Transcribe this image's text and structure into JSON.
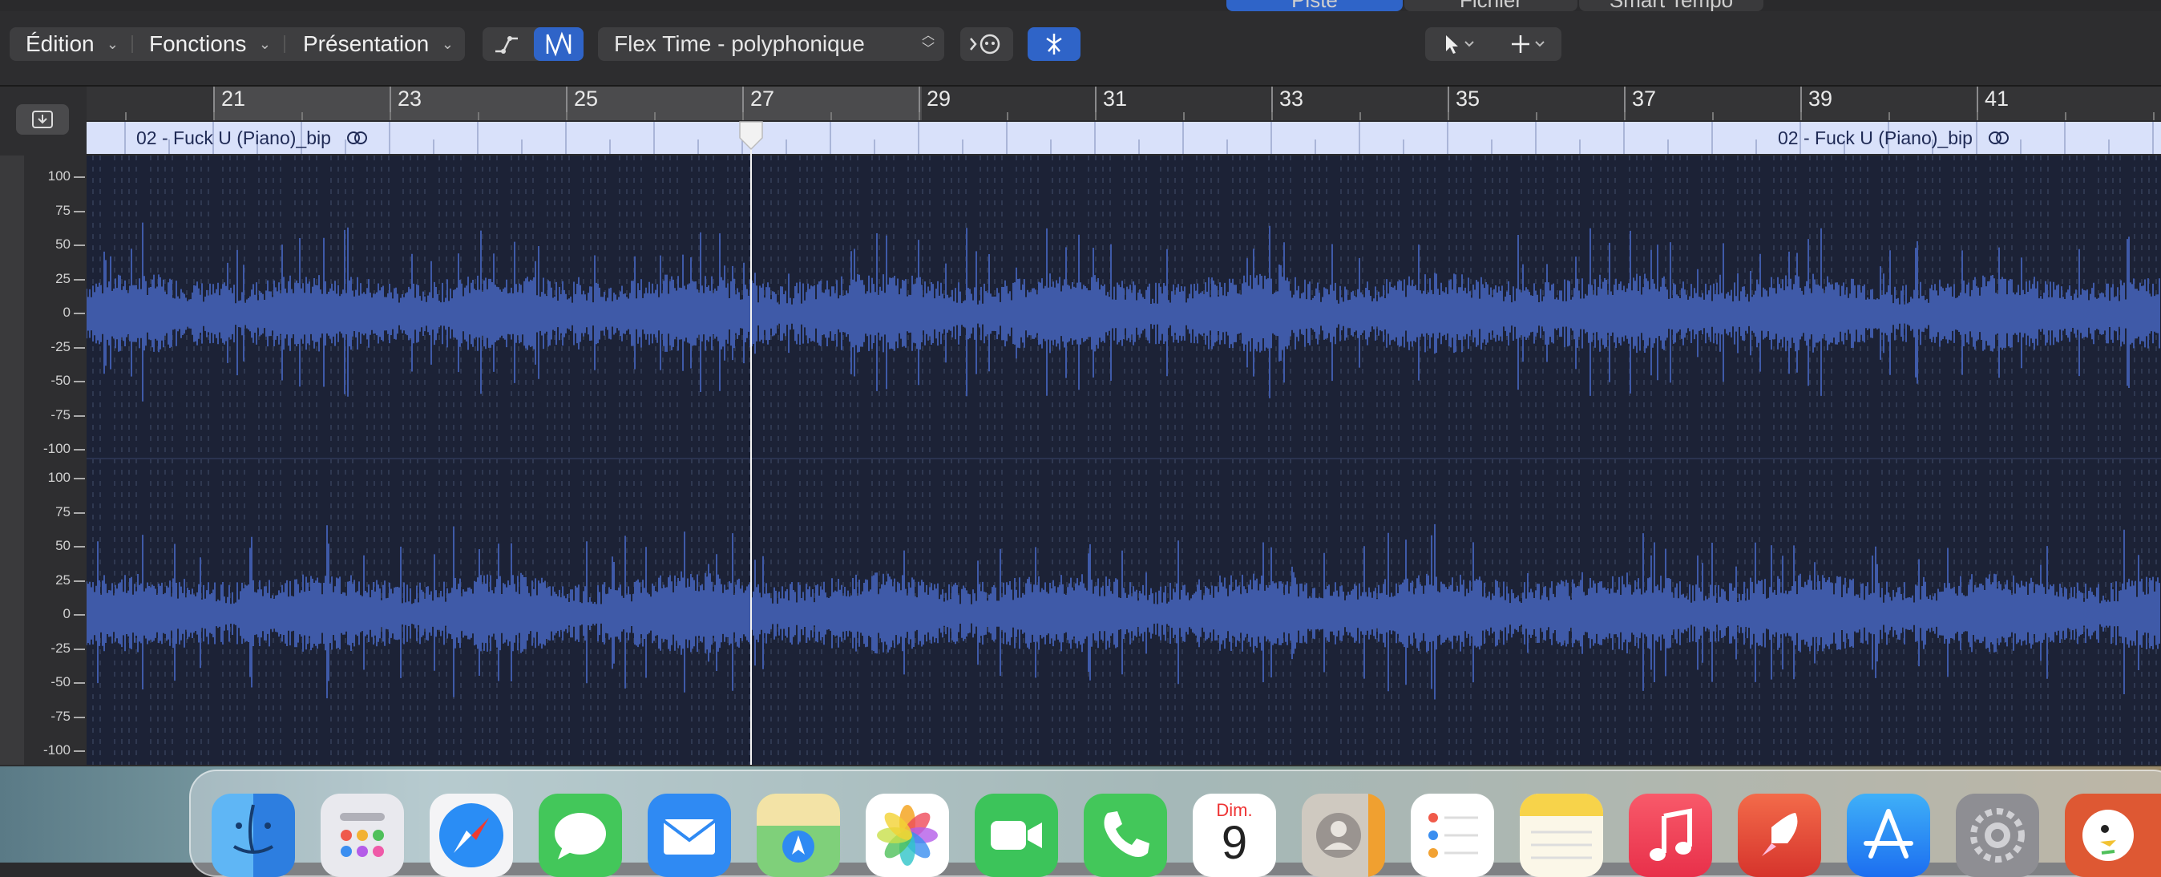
{
  "top_tabs": [
    "Piste",
    "Fichier",
    "Smart Tempo"
  ],
  "menus": [
    {
      "label": "Édition"
    },
    {
      "label": "Fonctions"
    },
    {
      "label": "Présentation"
    }
  ],
  "flex_mode": {
    "label": "Flex Time - polyphonique"
  },
  "ruler_bars": [
    "21",
    "23",
    "25",
    "27",
    "29",
    "31",
    "33",
    "35",
    "37",
    "39",
    "41"
  ],
  "region": {
    "name_1": "02 - Fuck U (Piano)_bip",
    "name_2": "02 - Fuck U (Piano)_bip"
  },
  "amplitude_scale": [
    "100",
    "75",
    "50",
    "25",
    "0",
    "-25",
    "-50",
    "-75",
    "-100"
  ],
  "dock": {
    "calendar_month": "Dim.",
    "calendar_day": "9",
    "apps": [
      "finder",
      "launchpad",
      "safari",
      "messages",
      "mail",
      "maps",
      "photos",
      "facetime",
      "phone",
      "calendar",
      "contacts",
      "reminders",
      "notes",
      "music",
      "rocket",
      "app-store",
      "system-settings",
      "duckduckgo"
    ]
  },
  "colors": {
    "accent": "#2f64c8",
    "waveform": "#3f5aa8",
    "waveform_bg": "#1c2236",
    "region": "#d9e1fa"
  }
}
